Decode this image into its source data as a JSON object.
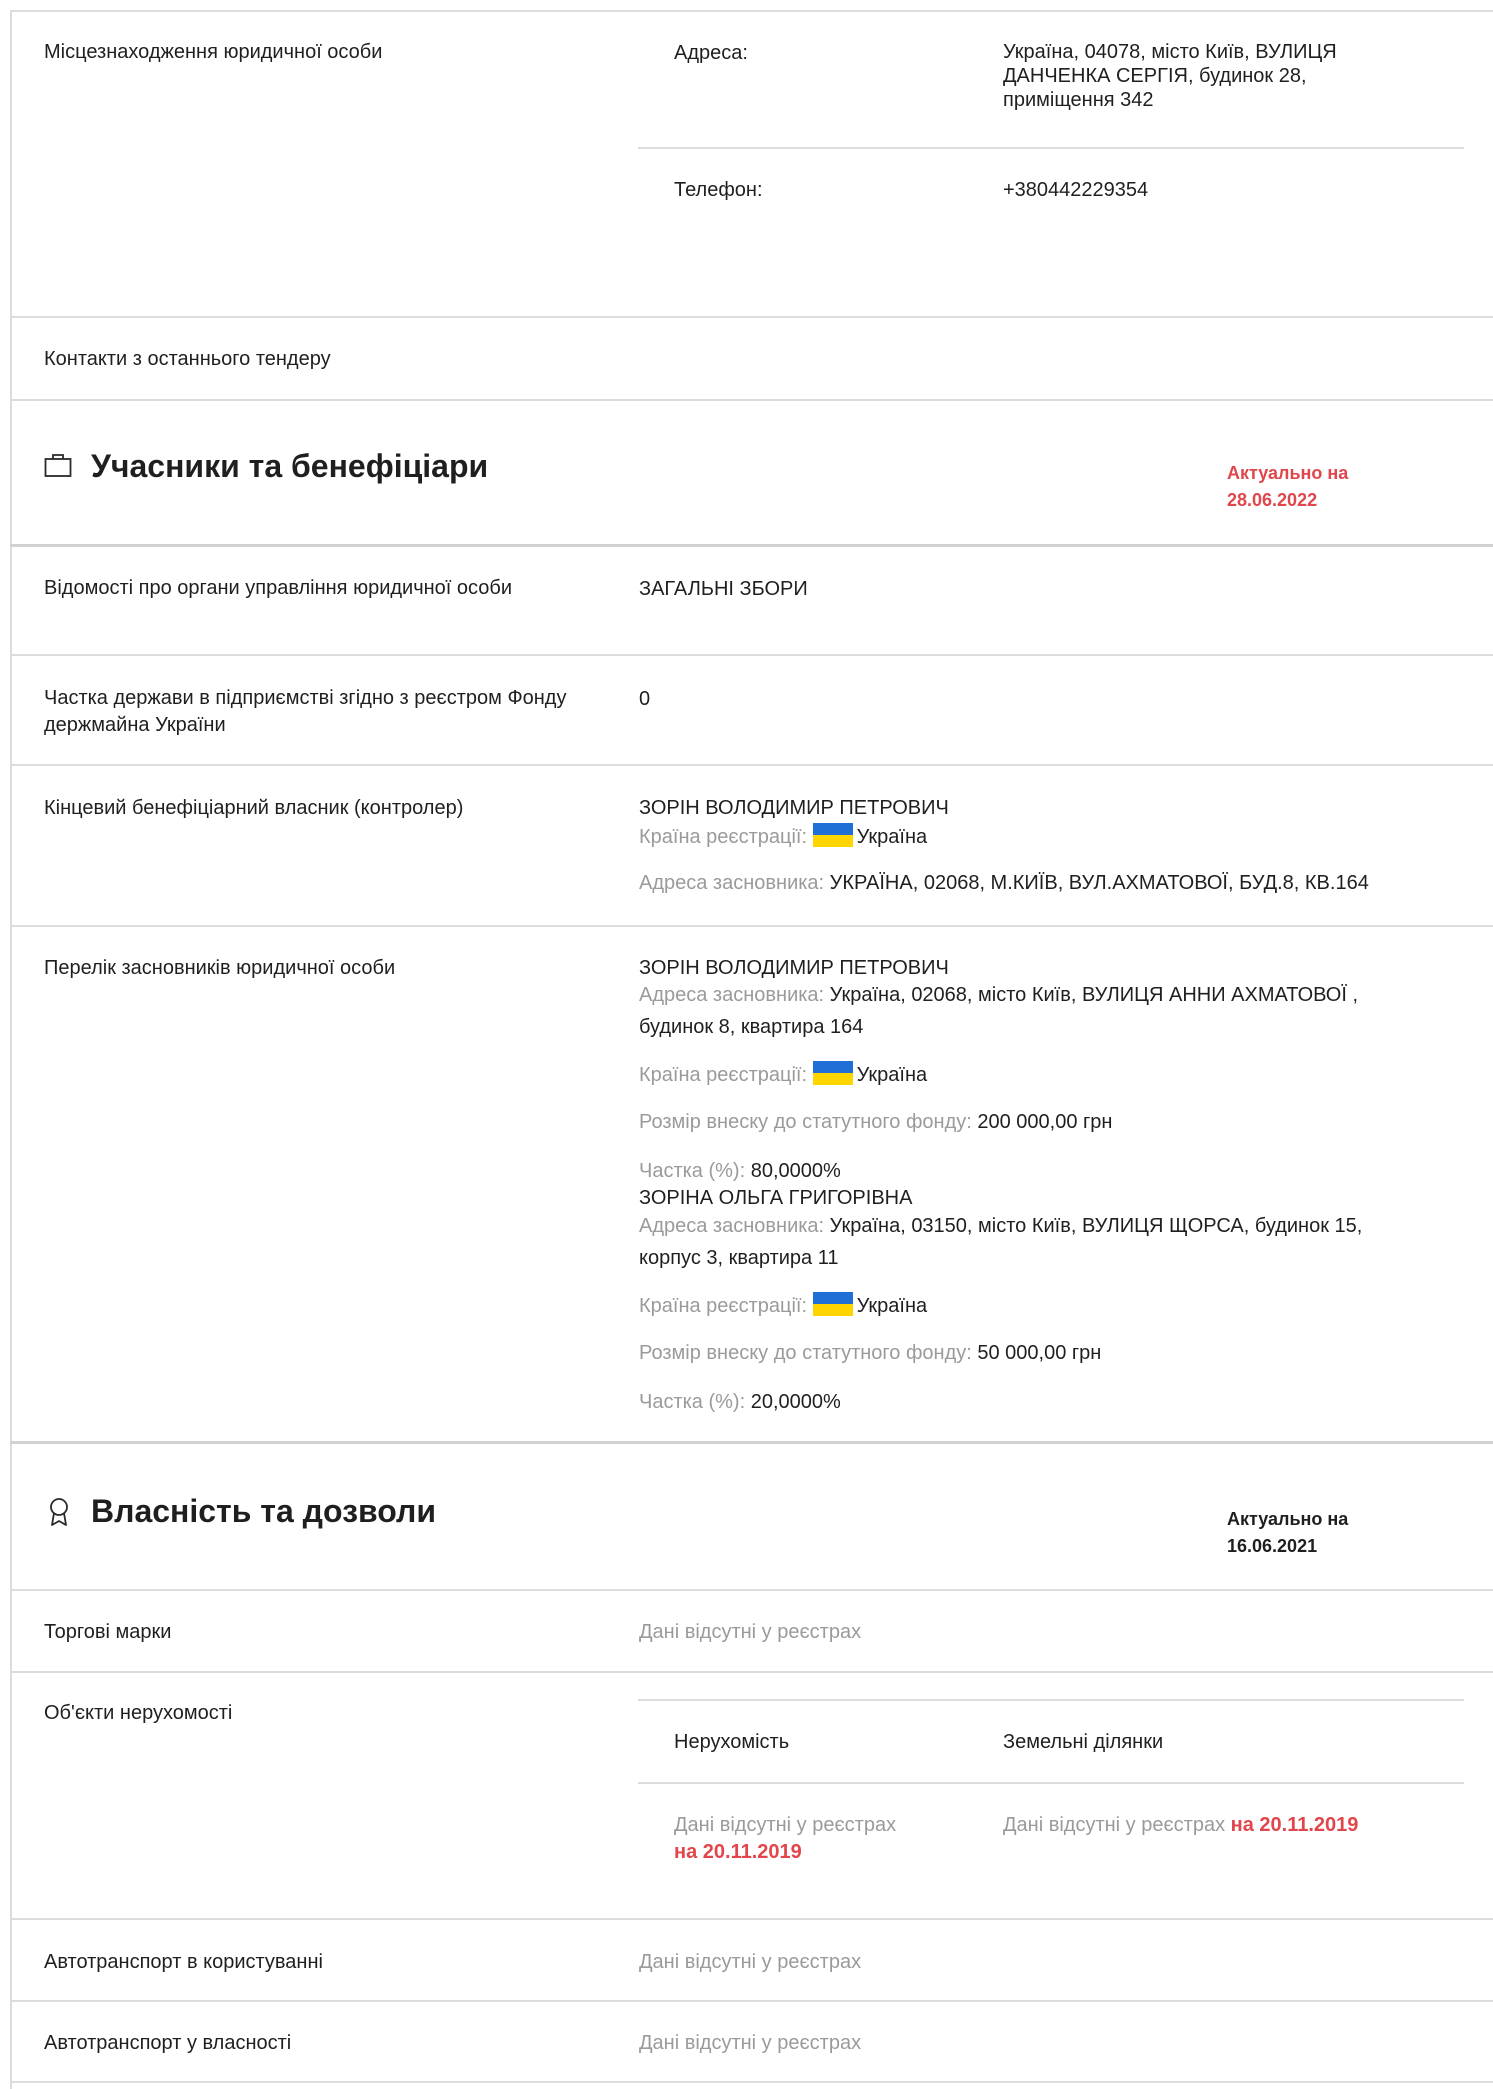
{
  "location": {
    "label": "Місцезнаходження юридичної особи",
    "address_label": "Адреса:",
    "address_value": "Україна, 04078, місто Київ, ВУЛИЦЯ ДАНЧЕНКА СЕРГІЯ, будинок 28, приміщення 342",
    "phone_label": "Телефон:",
    "phone_value": "+380442229354"
  },
  "contacts": {
    "label": "Контакти з останнього тендеру"
  },
  "participants": {
    "icon": "briefcase-icon",
    "title": "Учасники та бенефіціари",
    "actual_label": "Актуально на",
    "actual_date": "28.06.2022",
    "governance_label": "Відомості про органи управління юридичної особи",
    "governance_value": "ЗАГАЛЬНІ ЗБОРИ",
    "state_share_label": "Частка держави в підприємстві згідно з реєстром Фонду держмайна України",
    "state_share_value": "0",
    "beneficiary_label": "Кінцевий бенефіціарний власник (контролер)",
    "beneficiary": {
      "name": "ЗОРІН ВОЛОДИМИР ПЕТРОВИЧ",
      "country_label": "Країна реєстрації:",
      "country": "Україна",
      "address_label": "Адреса засновника:",
      "address": "УКРАЇНА, 02068, М.КИЇВ, ВУЛ.АХМАТОВОЇ, БУД.8, КВ.164"
    },
    "founders_label": "Перелік засновників юридичної особи",
    "founders": [
      {
        "name": "ЗОРІН ВОЛОДИМИР ПЕТРОВИЧ",
        "address_label": "Адреса засновника:",
        "address_line1": "Україна, 02068, місто Київ, ВУЛИЦЯ АННИ АХМАТОВОЇ ,",
        "address_line2": "будинок 8, квартира 164",
        "country_label": "Країна реєстрації:",
        "country": "Україна",
        "contribution_label": "Розмір внеску до статутного фонду:",
        "contribution": "200 000,00 грн",
        "share_label": "Частка (%):",
        "share": "80,0000%"
      },
      {
        "name": "ЗОРІНА ОЛЬГА ГРИГОРІВНА",
        "address_label": "Адреса засновника:",
        "address_line1": "Україна, 03150, місто Київ, ВУЛИЦЯ ЩОРСА, будинок 15,",
        "address_line2": "корпус 3, квартира 11",
        "country_label": "Країна реєстрації:",
        "country": "Україна",
        "contribution_label": "Розмір внеску до статутного фонду:",
        "contribution": "50 000,00 грн",
        "share_label": "Частка (%):",
        "share": "20,0000%"
      }
    ]
  },
  "property": {
    "icon": "award-icon",
    "title": "Власність та дозволи",
    "actual_label": "Актуально на",
    "actual_date": "16.06.2021",
    "trademarks_label": "Торгові марки",
    "no_data": "Дані відсутні у реєстрах",
    "real_estate_label": "Об'єкти нерухомості",
    "real_estate_col1": "Нерухомість",
    "real_estate_col2": "Земельні ділянки",
    "real_estate_on_date": "на 20.11.2019",
    "vehicles_used_label": "Автотранспорт в користуванні",
    "vehicles_owned_label": "Автотранспорт у власності"
  },
  "colors": {
    "accent_red": "#e0464b",
    "muted_text": "#9a9a9a",
    "divider": "#dcdcdc",
    "flag_blue": "#1f6fd6",
    "flag_yellow": "#ffd500"
  }
}
